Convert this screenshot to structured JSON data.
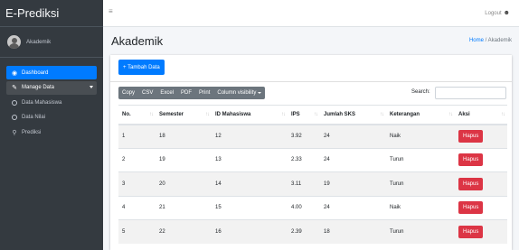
{
  "brand": "E-Prediksi",
  "user": {
    "name": "Akademik"
  },
  "sidebar": {
    "items": [
      {
        "label": "Dashboard",
        "icon": "dashboard-icon"
      },
      {
        "label": "Manage Data",
        "icon": "edit-icon"
      },
      {
        "label": "Data Mahasiswa",
        "icon": "circle-icon"
      },
      {
        "label": "Data Nilai",
        "icon": "circle-icon"
      },
      {
        "label": "Prediksi",
        "icon": "search-icon"
      }
    ]
  },
  "topbar": {
    "logout": "Logout"
  },
  "header": {
    "title": "Akademik",
    "breadcrumb_home": "Home",
    "breadcrumb_sep": "/",
    "breadcrumb_current": "Akademik"
  },
  "toolbar": {
    "add": "+ Tambah Data",
    "copy": "Copy",
    "csv": "CSV",
    "excel": "Excel",
    "pdf": "PDF",
    "print": "Print",
    "colvis": "Column visibility",
    "search_label": "Search:"
  },
  "table": {
    "columns": [
      "No.",
      "Semester",
      "ID Mahasiswa",
      "IPS",
      "Jumlah SKS",
      "Keterangan",
      "Aksi"
    ],
    "rows": [
      {
        "no": "1",
        "semester": "18",
        "id": "12",
        "ips": "3.92",
        "sks": "24",
        "ket": "Naik",
        "aksi": "Hapus"
      },
      {
        "no": "2",
        "semester": "19",
        "id": "13",
        "ips": "2.33",
        "sks": "24",
        "ket": "Turun",
        "aksi": "Hapus"
      },
      {
        "no": "3",
        "semester": "20",
        "id": "14",
        "ips": "3.11",
        "sks": "19",
        "ket": "Turun",
        "aksi": "Hapus"
      },
      {
        "no": "4",
        "semester": "21",
        "id": "15",
        "ips": "4.00",
        "sks": "24",
        "ket": "Naik",
        "aksi": "Hapus"
      },
      {
        "no": "5",
        "semester": "22",
        "id": "16",
        "ips": "2.39",
        "sks": "18",
        "ket": "Turun",
        "aksi": "Hapus"
      }
    ]
  }
}
